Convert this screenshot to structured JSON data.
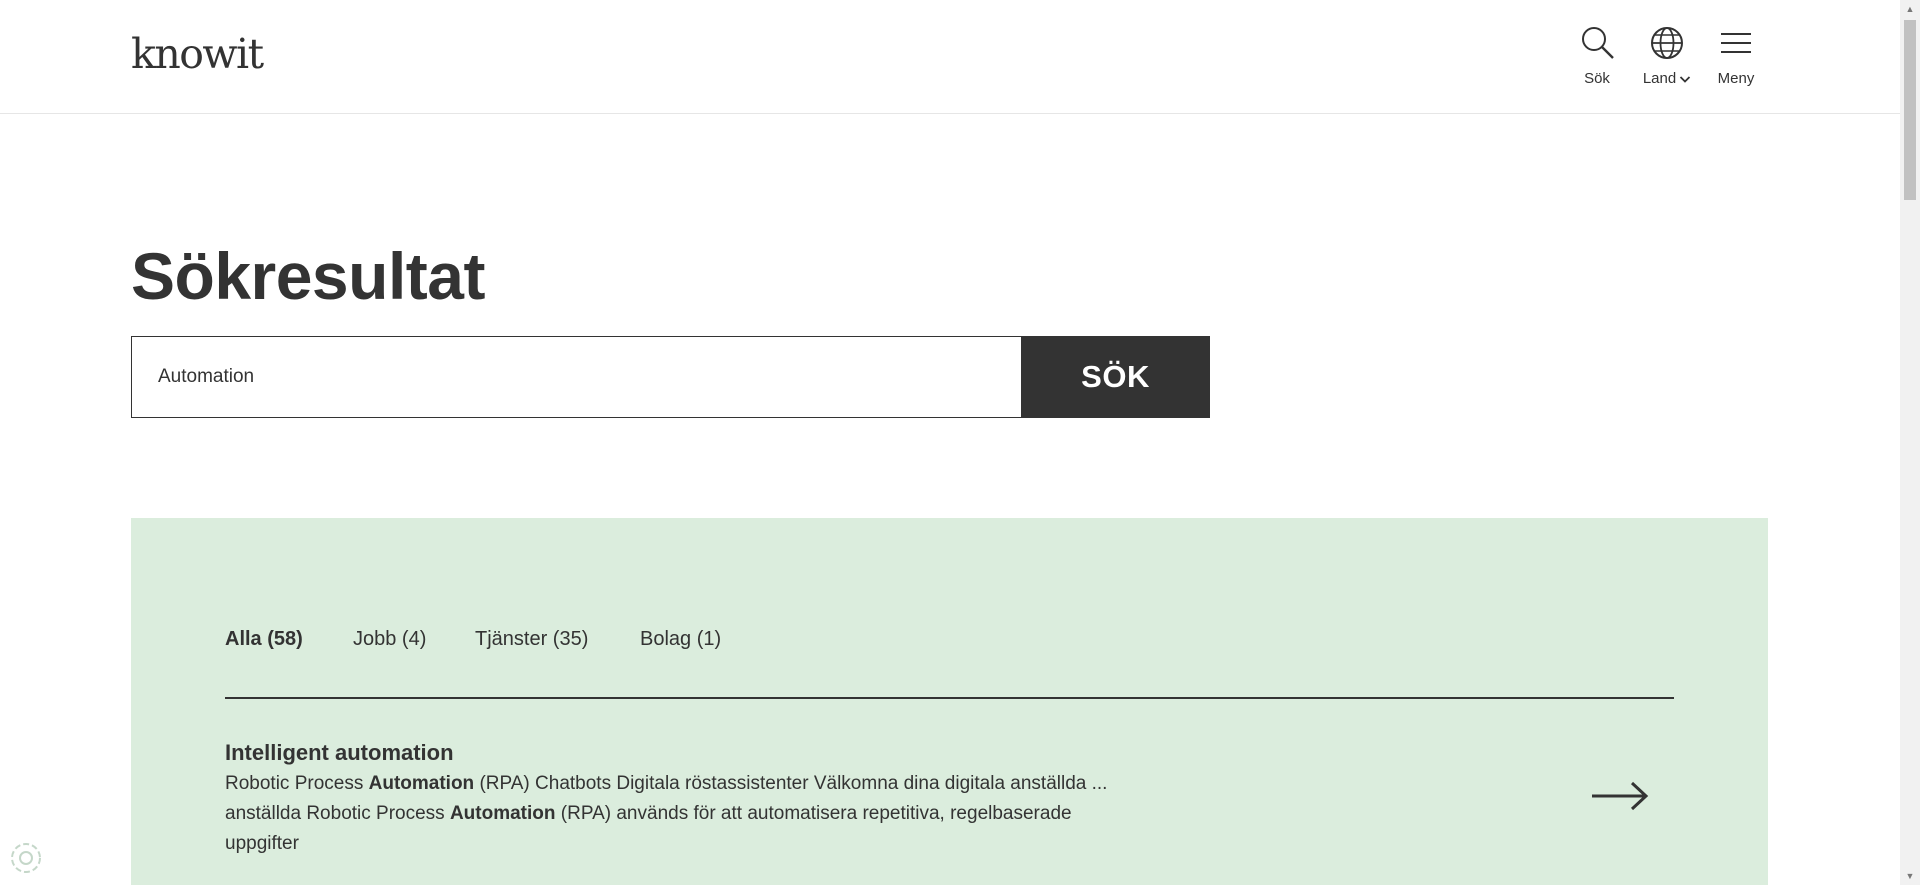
{
  "header": {
    "logo": "knowit",
    "nav": {
      "search_label": "Sök",
      "land_label": "Land",
      "menu_label": "Meny"
    }
  },
  "main": {
    "title": "Sökresultat",
    "search": {
      "value": "Automation",
      "button_label": "SÖK"
    }
  },
  "results": {
    "tabs": [
      {
        "label": "Alla (58)",
        "active": true
      },
      {
        "label": "Jobb (4)",
        "active": false
      },
      {
        "label": "Tjänster (35)",
        "active": false
      },
      {
        "label": "Bolag (1)",
        "active": false
      }
    ],
    "items": [
      {
        "title": "Intelligent automation",
        "snippet": [
          "Robotic Process ",
          "Automation",
          " (RPA) Chatbots Digitala röstassistenter Välkomna dina digitala anställda ... anställda Robotic Process ",
          "Automation",
          " (RPA) används för att automatisera repetitiva, regelbaserade uppgifter"
        ]
      }
    ]
  },
  "colors": {
    "text": "#333333",
    "results_background": "#dbeddd",
    "button_background": "#333333",
    "button_text": "#ffffff"
  },
  "icons": [
    "search-icon",
    "globe-icon",
    "chevron-down-icon",
    "hamburger-menu-icon",
    "arrow-right-icon",
    "cookie-settings-icon"
  ]
}
